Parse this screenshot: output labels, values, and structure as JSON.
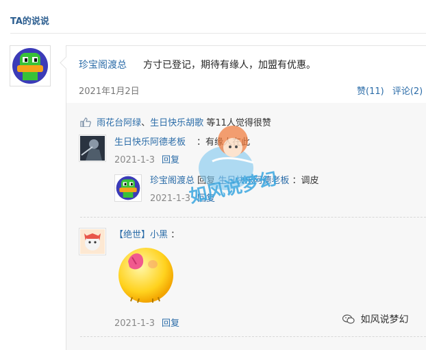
{
  "section": {
    "title": "TA的说说"
  },
  "post": {
    "author": "珍宝阁渡总",
    "text": "方寸已登记，期待有缘人，加盟有优惠。",
    "date": "2021年1月2日",
    "likes_label": "赞(11)",
    "comments_label": "评论(2)"
  },
  "likes": {
    "user1": "雨花台阿绿",
    "separator": "、",
    "user2": "生日快乐胡歌",
    "suffix": "等11人觉得很赞"
  },
  "comments": [
    {
      "author": "生日快乐阿德老板",
      "colon": "：",
      "text": "有缘人在此",
      "date": "2021-1-3",
      "reply_label": "回复"
    },
    {
      "author": "珍宝阁渡总",
      "reply_word": "回复",
      "target": "生日快乐阿德老板",
      "colon": "：",
      "text": "调皮",
      "date": "2021-1-3",
      "reply_label": "回复"
    },
    {
      "author": "【绝世】小黑",
      "colon": "：",
      "date": "2021-1-3",
      "reply_label": "回复"
    }
  ],
  "overlay_logo": "如风说梦幻",
  "footer_watermark": "如风说梦幻",
  "colors": {
    "link": "#2b6ca8",
    "title": "#2b5d8f"
  }
}
